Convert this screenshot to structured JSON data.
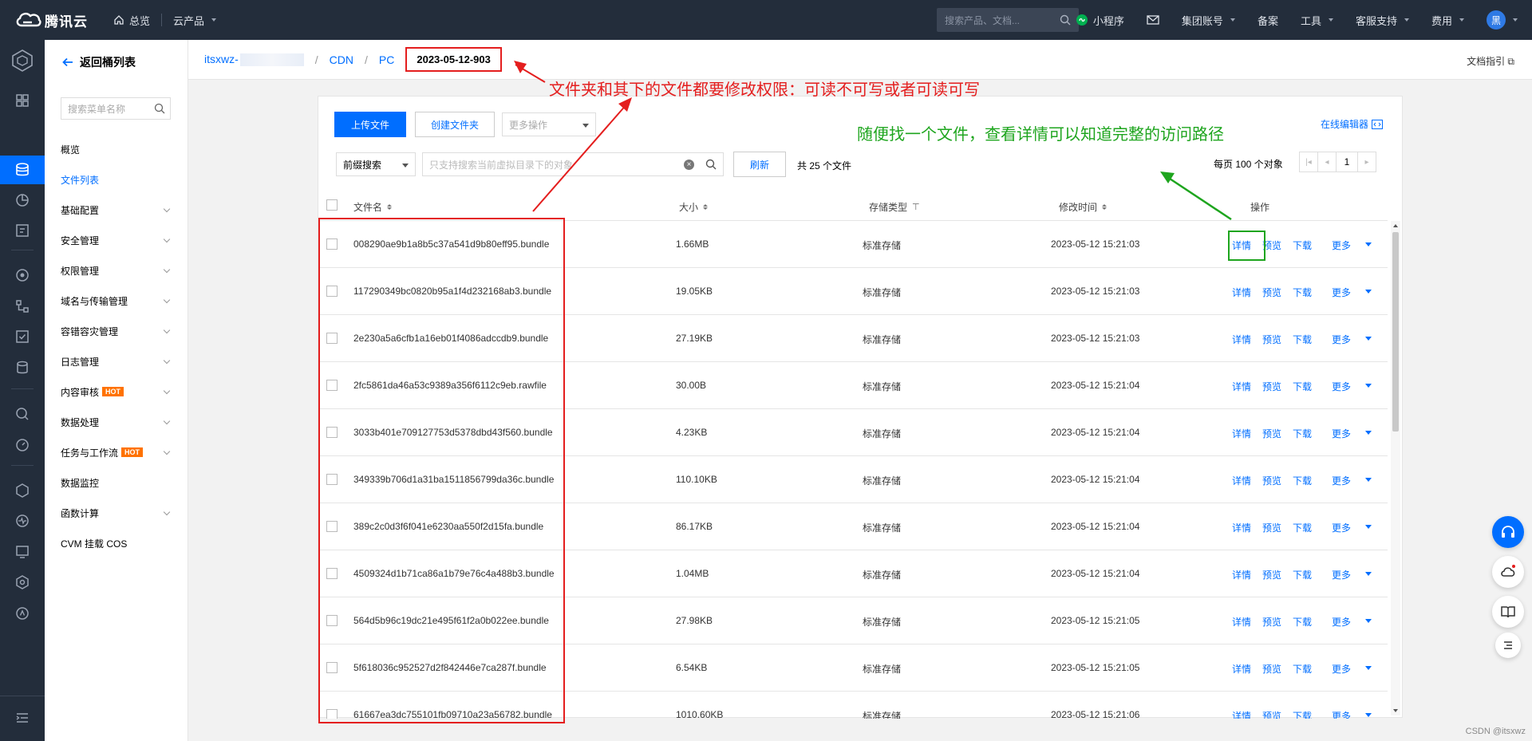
{
  "topbar": {
    "brand": "腾讯云",
    "overview": "总览",
    "products": "云产品",
    "search_placeholder": "搜索产品、文档...",
    "mini_program": "小程序",
    "group_account": "集团账号",
    "beian": "备案",
    "tools": "工具",
    "support": "客服支持",
    "fees": "费用",
    "avatar_text": "黑"
  },
  "sidebar": {
    "back_label": "返回桶列表",
    "search_placeholder": "搜索菜单名称",
    "items": [
      {
        "label": "概览",
        "has_chevron": false,
        "hot": false
      },
      {
        "label": "文件列表",
        "has_chevron": false,
        "hot": false
      },
      {
        "label": "基础配置",
        "has_chevron": true,
        "hot": false
      },
      {
        "label": "安全管理",
        "has_chevron": true,
        "hot": false
      },
      {
        "label": "权限管理",
        "has_chevron": true,
        "hot": false
      },
      {
        "label": "域名与传输管理",
        "has_chevron": true,
        "hot": false
      },
      {
        "label": "容错容灾管理",
        "has_chevron": true,
        "hot": false
      },
      {
        "label": "日志管理",
        "has_chevron": true,
        "hot": false
      },
      {
        "label": "内容审核",
        "has_chevron": true,
        "hot": true
      },
      {
        "label": "数据处理",
        "has_chevron": true,
        "hot": false
      },
      {
        "label": "任务与工作流",
        "has_chevron": true,
        "hot": true
      },
      {
        "label": "数据监控",
        "has_chevron": false,
        "hot": false
      },
      {
        "label": "函数计算",
        "has_chevron": true,
        "hot": false
      },
      {
        "label": "CVM 挂载 COS",
        "has_chevron": false,
        "hot": false
      }
    ],
    "hot_badge": "HOT"
  },
  "breadcrumb": {
    "bucket": "itsxwz-",
    "sep": "/",
    "cdn": "CDN",
    "pc": "PC",
    "current": "2023-05-12-903",
    "doc_guide": "文档指引"
  },
  "toolbar": {
    "upload": "上传文件",
    "create_folder": "创建文件夹",
    "more_ops": "更多操作",
    "online_editor": "在线编辑器",
    "prefix_search": "前缀搜索",
    "search_placeholder": "只支持搜索当前虚拟目录下的对象",
    "refresh": "刷新",
    "total": "共 25 个文件",
    "per_page": "每页 100 个对象",
    "page": "1"
  },
  "table": {
    "headers": {
      "name": "文件名",
      "size": "大小",
      "storage": "存储类型",
      "modified": "修改时间",
      "ops": "操作"
    },
    "actions": {
      "detail": "详情",
      "preview": "预览",
      "download": "下载",
      "more": "更多"
    },
    "rows": [
      {
        "name": "008290ae9b1a8b5c37a541d9b80eff95.bundle",
        "size": "1.66MB",
        "storage": "标准存储",
        "modified": "2023-05-12 15:21:03"
      },
      {
        "name": "117290349bc0820b95a1f4d232168ab3.bundle",
        "size": "19.05KB",
        "storage": "标准存储",
        "modified": "2023-05-12 15:21:03"
      },
      {
        "name": "2e230a5a6cfb1a16eb01f4086adccdb9.bundle",
        "size": "27.19KB",
        "storage": "标准存储",
        "modified": "2023-05-12 15:21:03"
      },
      {
        "name": "2fc5861da46a53c9389a356f6112c9eb.rawfile",
        "size": "30.00B",
        "storage": "标准存储",
        "modified": "2023-05-12 15:21:04"
      },
      {
        "name": "3033b401e709127753d5378dbd43f560.bundle",
        "size": "4.23KB",
        "storage": "标准存储",
        "modified": "2023-05-12 15:21:04"
      },
      {
        "name": "349339b706d1a31ba1511856799da36c.bundle",
        "size": "110.10KB",
        "storage": "标准存储",
        "modified": "2023-05-12 15:21:04"
      },
      {
        "name": "389c2c0d3f6f041e6230aa550f2d15fa.bundle",
        "size": "86.17KB",
        "storage": "标准存储",
        "modified": "2023-05-12 15:21:04"
      },
      {
        "name": "4509324d1b71ca86a1b79e76c4a488b3.bundle",
        "size": "1.04MB",
        "storage": "标准存储",
        "modified": "2023-05-12 15:21:04"
      },
      {
        "name": "564d5b96c19dc21e495f61f2a0b022ee.bundle",
        "size": "27.98KB",
        "storage": "标准存储",
        "modified": "2023-05-12 15:21:05"
      },
      {
        "name": "5f618036c952527d2f842446e7ca287f.bundle",
        "size": "6.54KB",
        "storage": "标准存储",
        "modified": "2023-05-12 15:21:05"
      },
      {
        "name": "61667ea3dc755101fb09710a23a56782.bundle",
        "size": "1010.60KB",
        "storage": "标准存储",
        "modified": "2023-05-12 15:21:06"
      }
    ]
  },
  "annotations": {
    "red_note": "文件夹和其下的文件都要修改权限：可读不可写或者可读可写",
    "green_note": "随便找一个文件，查看详情可以知道完整的访问路径",
    "red_color": "#e41e1e",
    "green_color": "#1ea51e"
  },
  "watermark": "CSDN @itsxwz",
  "colors": {
    "brand": "#006eff",
    "topbar": "#232d3b"
  }
}
